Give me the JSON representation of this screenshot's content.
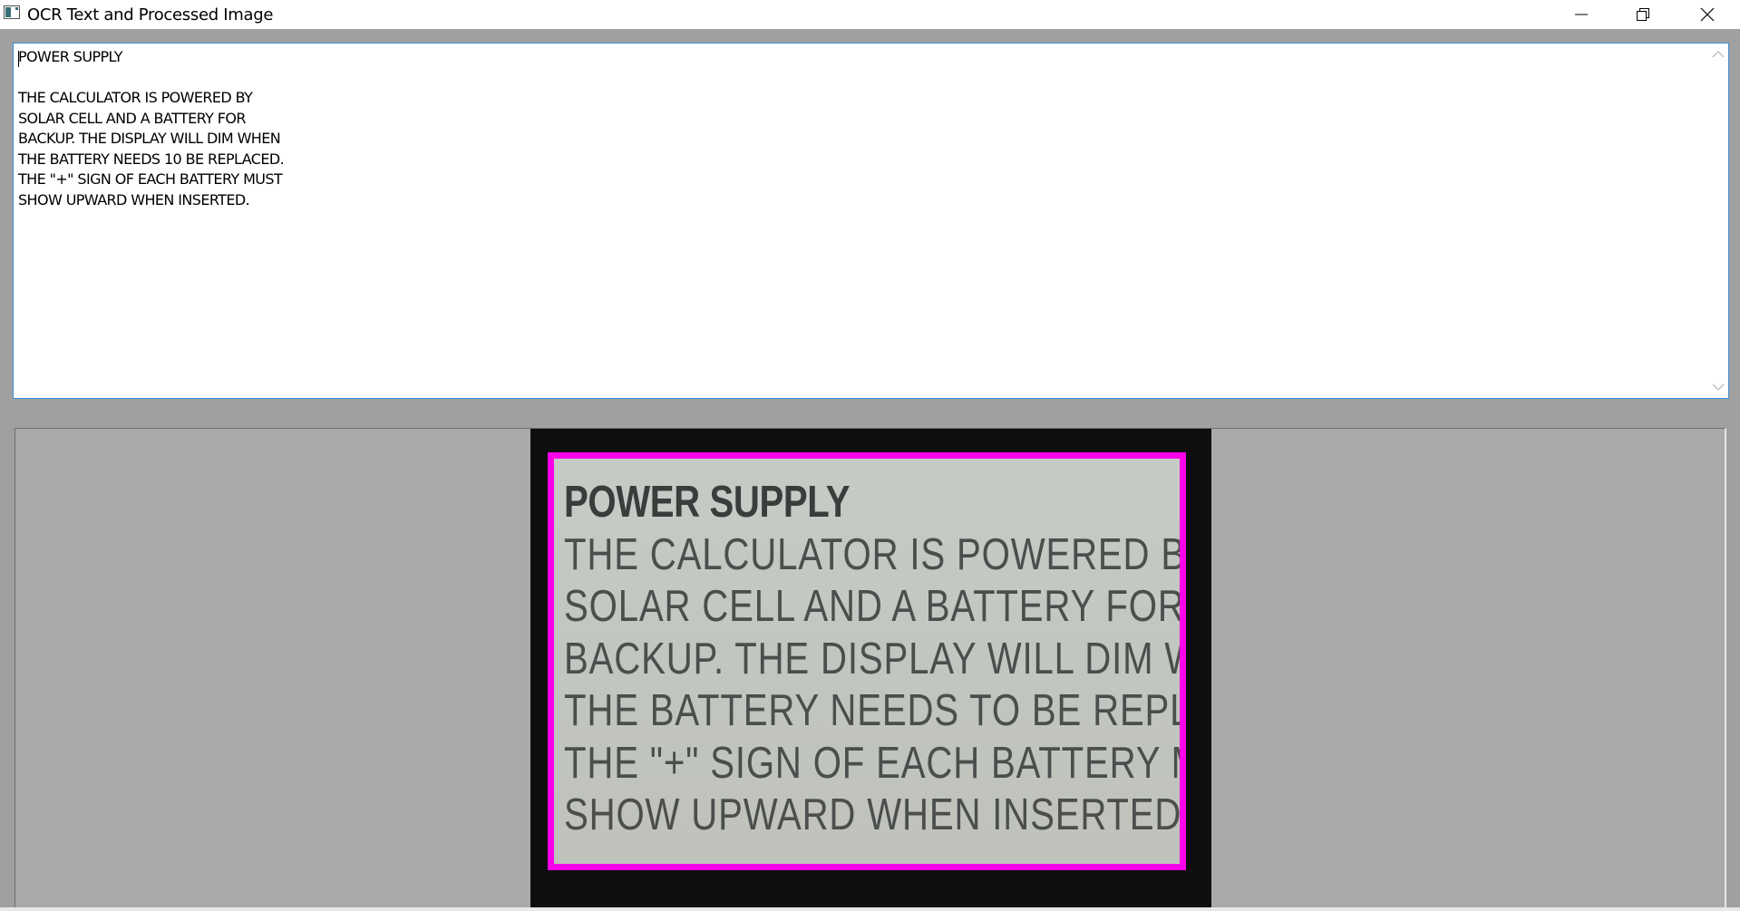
{
  "window": {
    "title": "OCR Text and Processed Image",
    "controls": {
      "minimize_icon": "minimize-icon",
      "maximize_icon": "restore-icon",
      "close_icon": "close-icon"
    }
  },
  "ocr_text": {
    "value": "POWER SUPPLY\n\nTHE CALCULATOR IS POWERED BY\nSOLAR CELL AND A BATTERY FOR\nBACKUP. THE DISPLAY WILL DIM WHEN\nTHE BATTERY NEEDS 10 BE REPLACED.\nTHE \"+\" SIGN OF EACH BATTERY MUST\nSHOW UPWARD WHEN INSERTED."
  },
  "processed_image": {
    "heading": "POWER SUPPLY",
    "body": "THE CALCULATOR IS POWERED BY\nSOLAR CELL AND A BATTERY FOR\nBACKUP. THE DISPLAY WILL DIM WHEN\nTHE BATTERY NEEDS TO BE REPLACED.\nTHE \"+\" SIGN OF EACH BATTERY MUST\nSHOW UPWARD WHEN INSERTED.",
    "highlight_color": "#ff00e8",
    "frame_color": "#0e0e0e"
  },
  "colors": {
    "window_background": "#a0a0a0",
    "text_area_border": "#3c8fd6"
  }
}
